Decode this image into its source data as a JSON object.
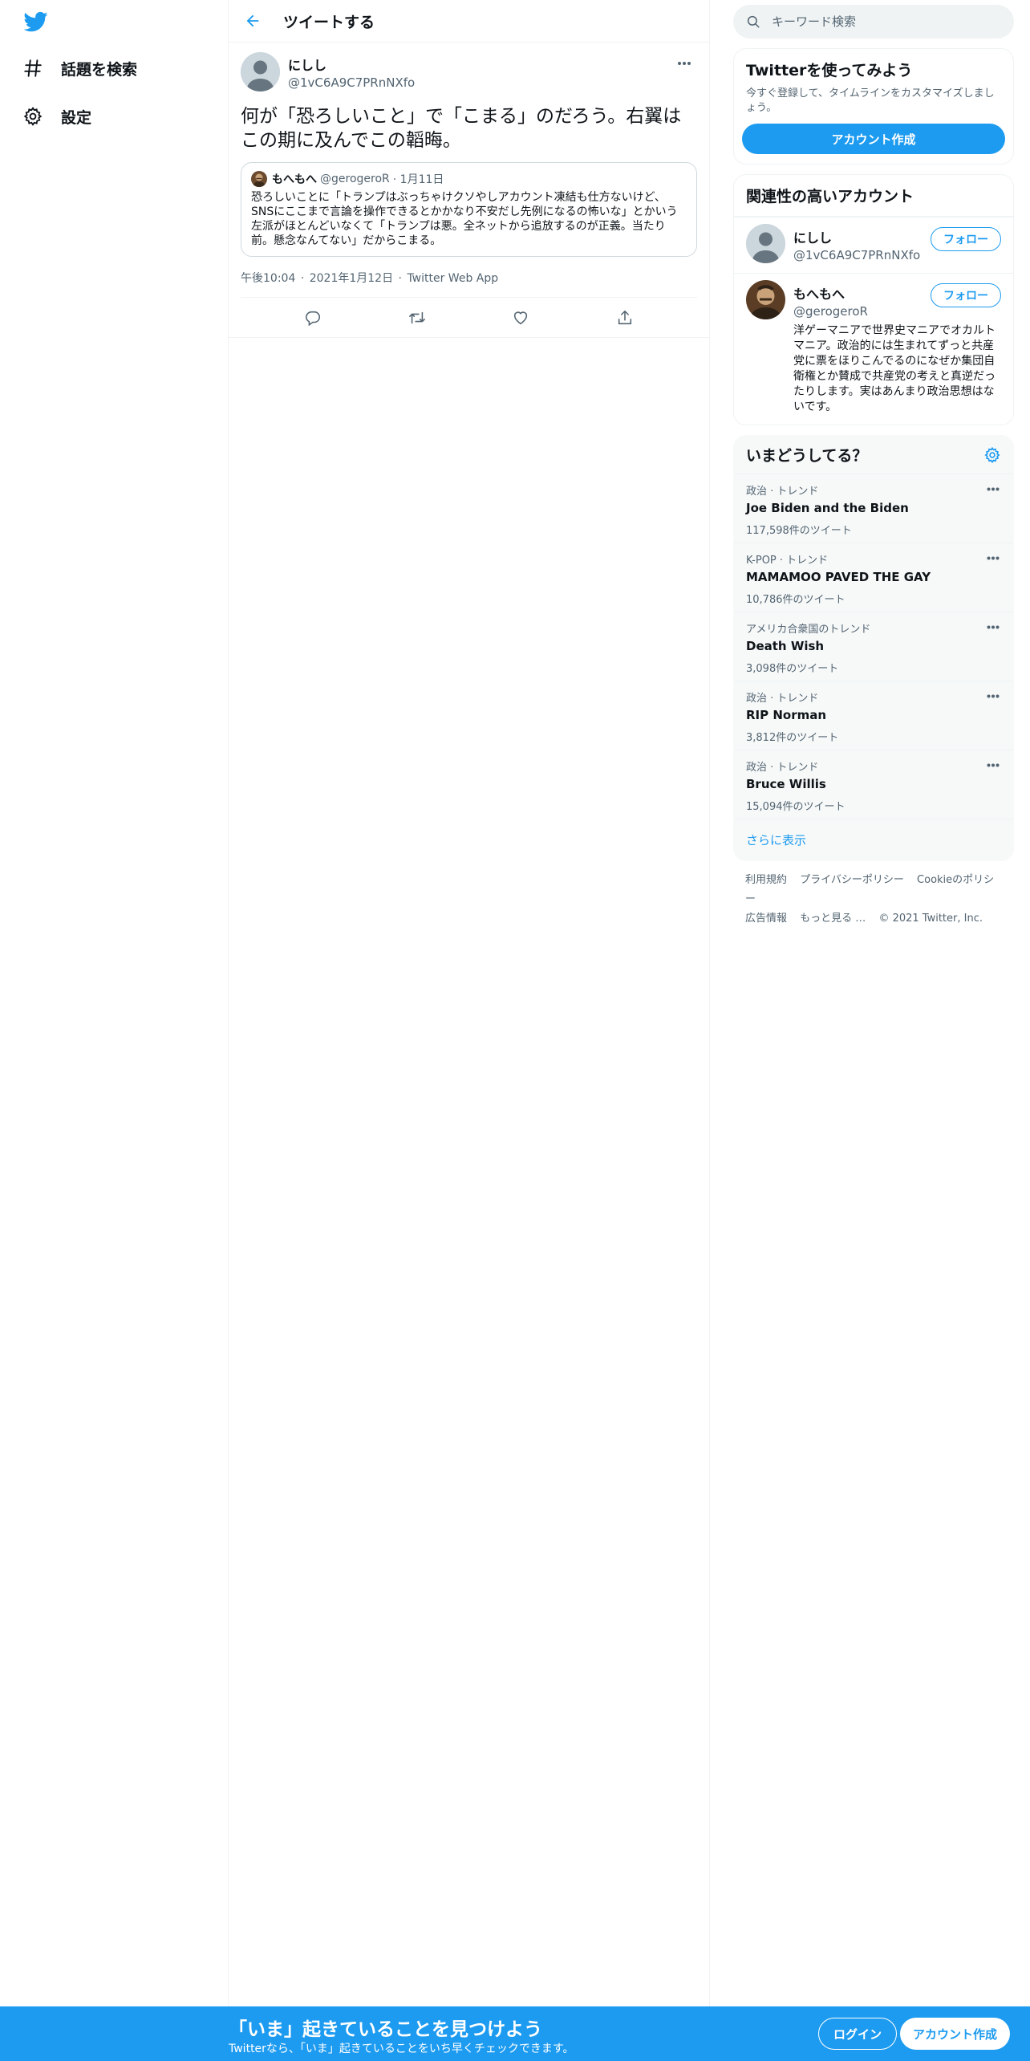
{
  "colors": {
    "accent": "#1d9bf0",
    "text": "#0f1419",
    "secondary": "#536471",
    "border": "#eff3f4"
  },
  "nav": {
    "items": [
      {
        "label": "話題を検索",
        "icon": "hashtag-icon"
      },
      {
        "label": "設定",
        "icon": "gear-icon"
      }
    ]
  },
  "center": {
    "title": "ツイートする"
  },
  "tweet": {
    "name": "にしし",
    "handle": "@1vC6A9C7PRnNXfo",
    "text": "何が「恐ろしいこと」で「こまる」のだろう。右翼はこの期に及んでこの韜晦。",
    "quote": {
      "name": "もへもへ",
      "handle": "@gerogeroR",
      "date": "· 1月11日",
      "text": "恐ろしいことに「トランプはぶっちゃけクソやしアカウント凍結も仕方ないけど、SNSにここまで言論を操作できるとかかなり不安だし先例になるの怖いな」とかいう左派がほとんどいなくて「トランプは悪。全ネットから追放するのが正義。当たり前。懸念なんてない」だからこまる。"
    },
    "time": "午後10:04",
    "sep1": "·",
    "date": "2021年1月12日",
    "sep2": "·",
    "source": "Twitter Web App"
  },
  "search": {
    "placeholder": "キーワード検索"
  },
  "signup_card": {
    "title": "Twitterを使ってみよう",
    "subtitle": "今すぐ登録して、タイムラインをカスタマイズしましょう。",
    "button": "アカウント作成"
  },
  "relevant": {
    "title": "関連性の高いアカウント",
    "accounts": [
      {
        "name": "にしし",
        "handle": "@1vC6A9C7PRnNXfo",
        "follow": "フォロー",
        "bio": ""
      },
      {
        "name": "もへもへ",
        "handle": "@gerogeroR",
        "follow": "フォロー",
        "bio": "洋ゲーマニアで世界史マニアでオカルトマニア。政治的には生まれてずっと共産党に票をほりこんでるのになぜか集団自衛権とか賛成で共産党の考えと真逆だったりします。実はあんまり政治思想はないです。"
      }
    ]
  },
  "trends": {
    "title": "いまどうしてる？",
    "items": [
      {
        "context": "政治 · トレンド",
        "name": "Joe Biden and the Biden",
        "count": "117,598件のツイート"
      },
      {
        "context": "K-POP · トレンド",
        "name": "MAMAMOO PAVED THE GAY",
        "count": "10,786件のツイート"
      },
      {
        "context": "アメリカ合衆国のトレンド",
        "name": "Death Wish",
        "count": "3,098件のツイート"
      },
      {
        "context": "政治 · トレンド",
        "name": "RIP Norman",
        "count": "3,812件のツイート"
      },
      {
        "context": "政治 · トレンド",
        "name": "Bruce Willis",
        "count": "15,094件のツイート"
      }
    ],
    "show_more": "さらに表示"
  },
  "footer": {
    "terms": "利用規約",
    "privacy": "プライバシーポリシー",
    "cookie": "Cookieのポリシー",
    "ads": "広告情報",
    "more": "もっと見る …",
    "copyright": "© 2021 Twitter, Inc."
  },
  "bottom_bar": {
    "title": "「いま」起きていることを見つけよう",
    "subtitle": "Twitterなら、「いま」起きていることをいち早くチェックできます。",
    "login": "ログイン",
    "signup": "アカウント作成"
  }
}
